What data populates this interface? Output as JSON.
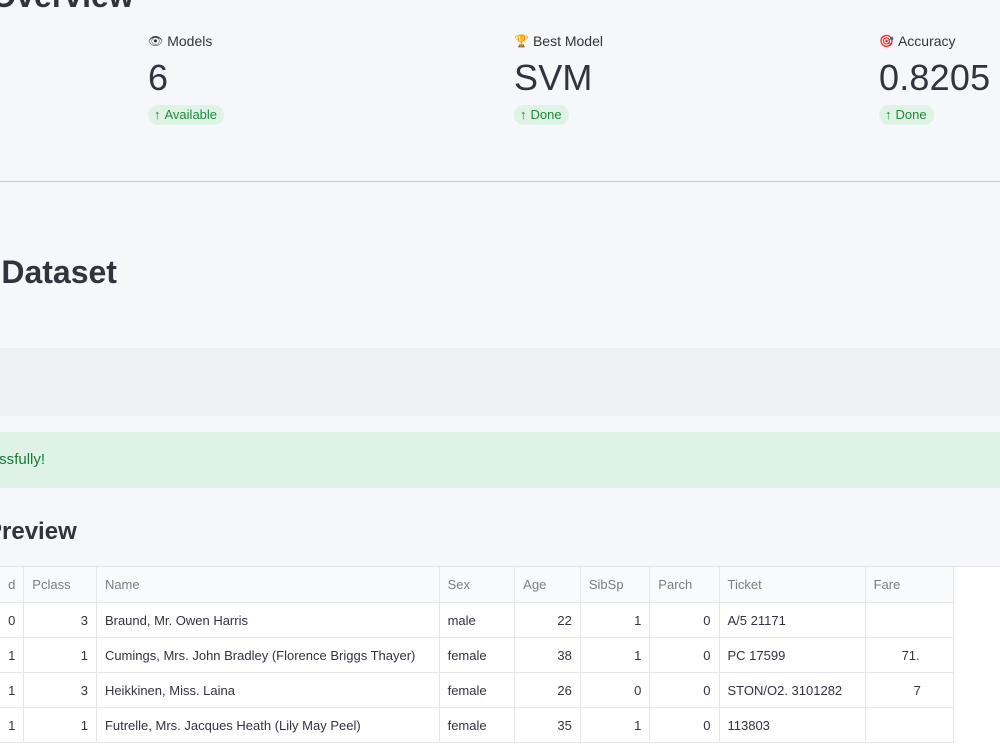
{
  "page": {
    "section_title": "Overview",
    "dataset_title": "Dataset",
    "preview_title": "w"
  },
  "metrics": [
    {
      "icon": "👁",
      "label": "Models",
      "value": "6",
      "delta": "Available"
    },
    {
      "icon": "🏆",
      "label": "Best Model",
      "value": "SVM",
      "delta": "Done"
    },
    {
      "icon": "🎯",
      "label": "Accuracy",
      "value": "0.8205",
      "delta": "Done"
    }
  ],
  "delta_arrow": "↑",
  "success": {
    "message": "fully!"
  },
  "colors": {
    "success_bg": "#def2e5",
    "success_text": "#1a7a36",
    "delta_bg": "#dff3e4",
    "delta_text": "#1c8a3f"
  },
  "table": {
    "columns": [
      "d",
      "Pclass",
      "Name",
      "Sex",
      "Age",
      "SibSp",
      "Parch",
      "Ticket",
      "Fare"
    ],
    "rows": [
      [
        "0",
        "3",
        "Braund, Mr. Owen Harris",
        "male",
        "22",
        "1",
        "0",
        "A/5 21171",
        ""
      ],
      [
        "1",
        "1",
        "Cumings, Mrs. John Bradley (Florence Briggs Thayer)",
        "female",
        "38",
        "1",
        "0",
        "PC 17599",
        "71."
      ],
      [
        "1",
        "3",
        "Heikkinen, Miss. Laina",
        "female",
        "26",
        "0",
        "0",
        "STON/O2. 3101282",
        "7"
      ],
      [
        "1",
        "1",
        "Futrelle, Mrs. Jacques Heath (Lily May Peel)",
        "female",
        "35",
        "1",
        "0",
        "113803",
        ""
      ]
    ]
  }
}
